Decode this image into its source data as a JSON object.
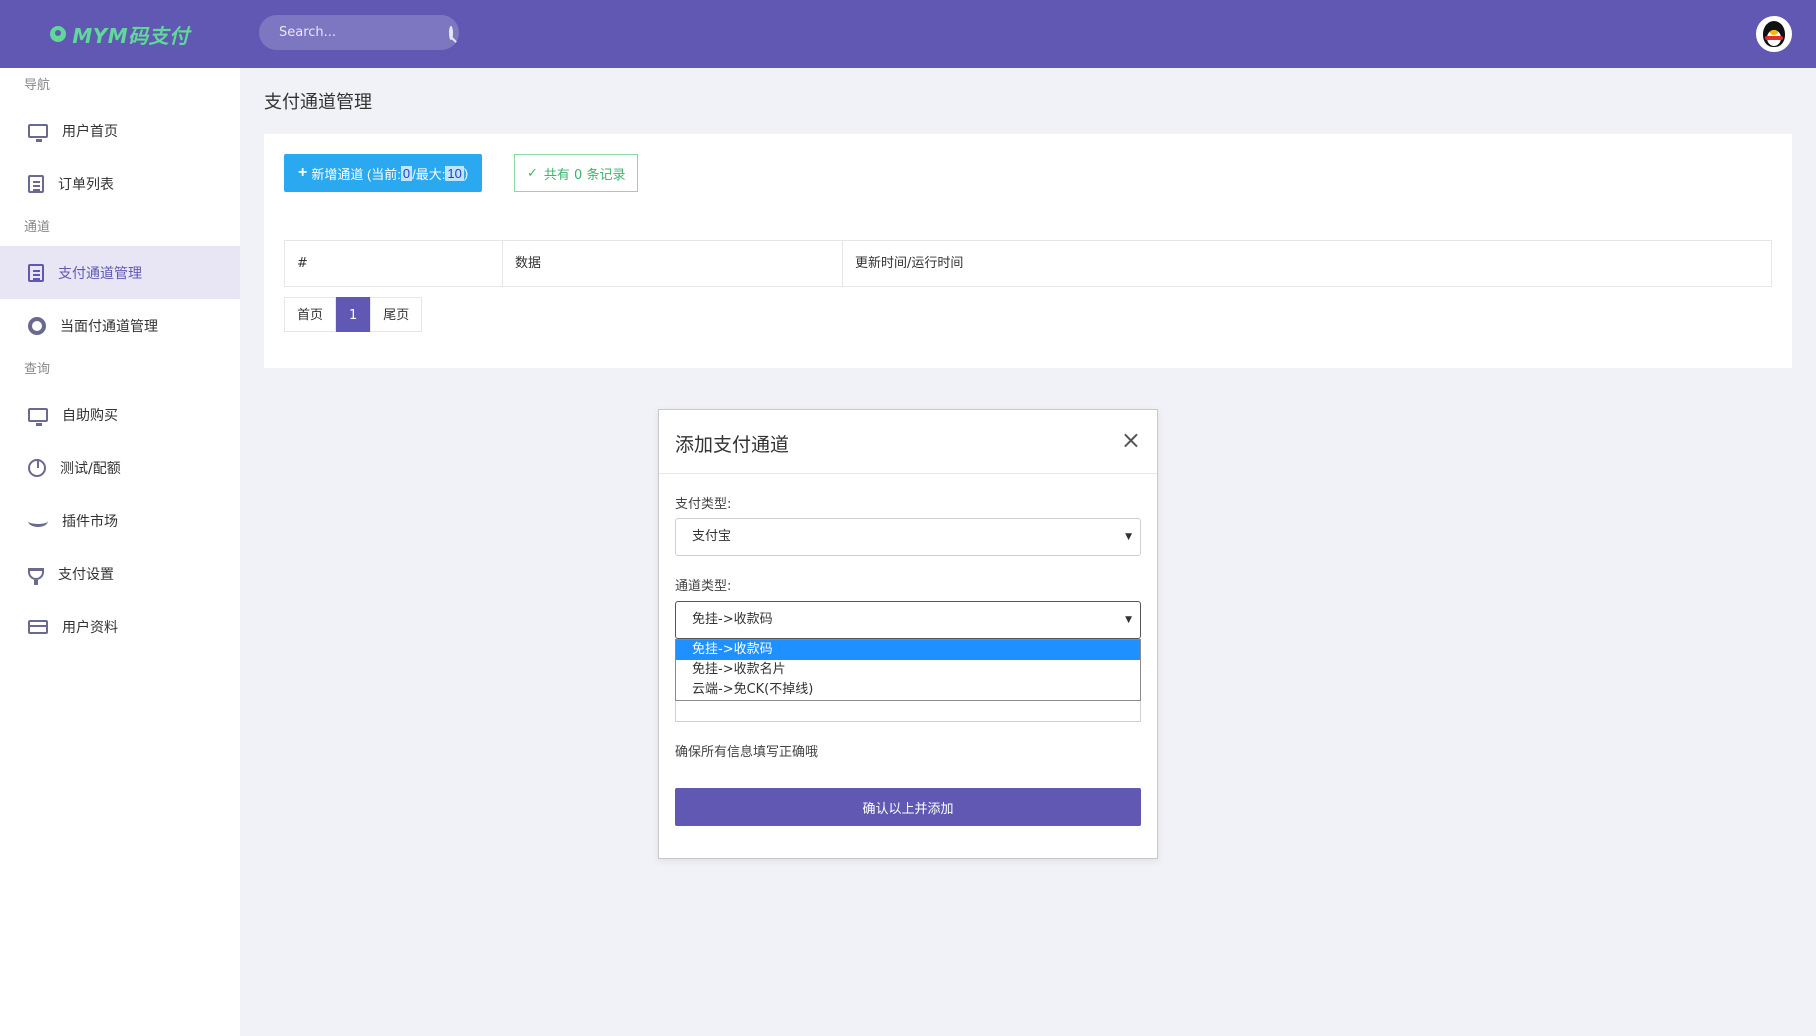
{
  "header": {
    "brand": "MYM码支付",
    "search_placeholder": "Search..."
  },
  "sidebar": {
    "sections": [
      {
        "label": "导航",
        "items": [
          {
            "label": "用户首页",
            "icon": "monitor-icon"
          },
          {
            "label": "订单列表",
            "icon": "clipboard-icon"
          }
        ]
      },
      {
        "label": "通道",
        "items": [
          {
            "label": "支付通道管理",
            "icon": "clipboard-icon",
            "active": true
          },
          {
            "label": "当面付通道管理",
            "icon": "lifebuoy-icon"
          }
        ]
      },
      {
        "label": "查询",
        "items": [
          {
            "label": "自助购买",
            "icon": "monitor-icon"
          },
          {
            "label": "测试/配额",
            "icon": "pie-chart-icon"
          },
          {
            "label": "插件市场",
            "icon": "wave-icon"
          },
          {
            "label": "支付设置",
            "icon": "trophy-icon"
          },
          {
            "label": "用户资料",
            "icon": "card-icon"
          }
        ]
      }
    ]
  },
  "main": {
    "title": "支付通道管理",
    "add_button": {
      "prefix": "新增通道 (当前: ",
      "current": "0",
      "middle": "/最大: ",
      "max": "10",
      "suffix": ")"
    },
    "record_count": "共有 0 条记录",
    "table_headers": [
      "#",
      "数据",
      "更新时间/运行时间"
    ],
    "pager": {
      "first": "首页",
      "current": "1",
      "last": "尾页"
    }
  },
  "modal": {
    "title": "添加支付通道",
    "pay_type_label": "支付类型:",
    "pay_type_value": "支付宝",
    "channel_type_label": "通道类型:",
    "channel_type_value": "免挂->收款码",
    "channel_options": [
      "免挂->收款码",
      "免挂->收款名片",
      "云端->免CK(不掉线)"
    ],
    "note": "确保所有信息填写正确哦",
    "confirm_label": "确认以上并添加"
  },
  "colors": {
    "primary": "#6158b3",
    "accent_blue": "#2aa8f0",
    "success": "#3cb46e",
    "option_selected": "#1e90ff"
  }
}
